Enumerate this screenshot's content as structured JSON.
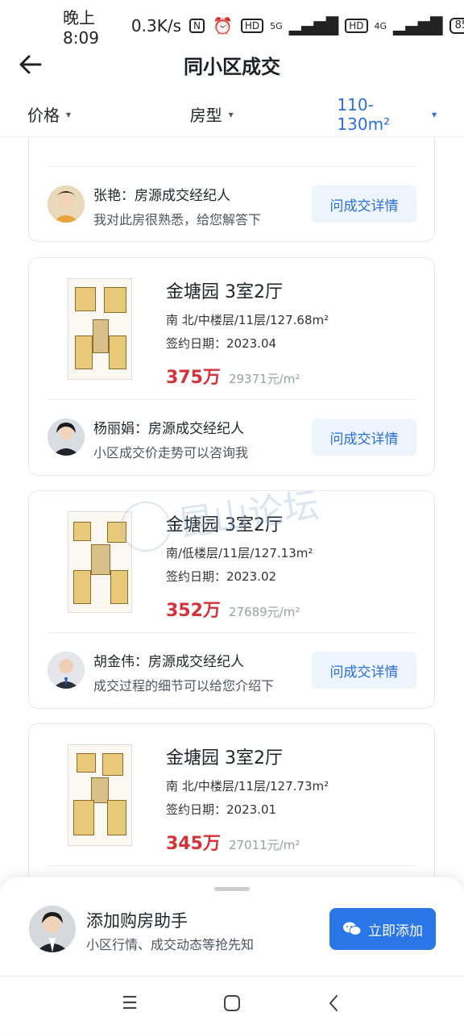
{
  "status_bar": {
    "time": "晚上8:09",
    "speed": "0.3K/s",
    "battery": "85",
    "net1": "5G",
    "net2": "4G",
    "hd": "HD"
  },
  "header": {
    "title": "同小区成交"
  },
  "filters": {
    "price": "价格",
    "layout": "房型",
    "area": "110-130m²"
  },
  "listings": [
    {
      "agent": {
        "name": "张艳：房源成交经纪人",
        "message": "我对此房很熟悉，给您解答下"
      },
      "ask_label": "问成交详情"
    },
    {
      "name": "金塘园 3室2厅",
      "detail": "南 北/中楼层/11层/127.68m²",
      "date": "签约日期：2023.04",
      "price": "375万",
      "unit_price": "29371元/m²",
      "agent": {
        "name": "杨丽娟：房源成交经纪人",
        "message": "小区成交价走势可以咨询我"
      },
      "ask_label": "问成交详情"
    },
    {
      "name": "金塘园 3室2厅",
      "detail": "南/低楼层/11层/127.13m²",
      "date": "签约日期：2023.02",
      "price": "352万",
      "unit_price": "27689元/m²",
      "agent": {
        "name": "胡金伟：房源成交经纪人",
        "message": "成交过程的细节可以给您介绍下"
      },
      "ask_label": "问成交详情"
    },
    {
      "name": "金塘园 3室2厅",
      "detail": "南 北/中楼层/11层/127.73m²",
      "date": "签约日期：2023.01",
      "price": "345万",
      "unit_price": "27011元/m²"
    }
  ],
  "watermark": {
    "text": "昆山论坛"
  },
  "assistant": {
    "title": "添加购房助手",
    "subtitle": "小区行情、成交动态等抢先知",
    "button": "立即添加"
  },
  "colors": {
    "accent": "#2a6fdb",
    "price": "#d6323a",
    "button": "#2a75e8"
  }
}
